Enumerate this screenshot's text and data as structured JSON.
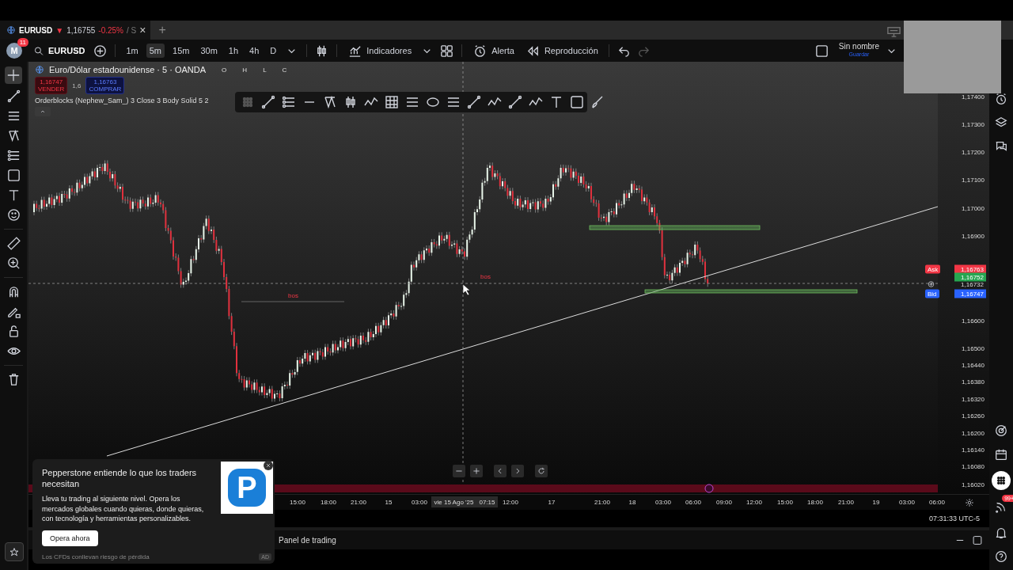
{
  "tab": {
    "symbol": "EURUSD",
    "arrow": "▼",
    "price": "1,16755",
    "change": "-0.25%",
    "extra": "/ S",
    "close": "×",
    "add": "+"
  },
  "toolbar": {
    "avatar": "M",
    "notifications": "11",
    "symbol": "EURUSD",
    "intervals": [
      {
        "label": "1m",
        "selected": false
      },
      {
        "label": "5m",
        "selected": true
      },
      {
        "label": "15m",
        "selected": false
      },
      {
        "label": "30m",
        "selected": false
      },
      {
        "label": "1h",
        "selected": false
      },
      {
        "label": "4h",
        "selected": false
      },
      {
        "label": "D",
        "selected": false
      }
    ],
    "indicators": "Indicadores",
    "alert": "Alerta",
    "replay": "Reproducción",
    "layout_name": "Sin nombre",
    "save": "Guardar"
  },
  "legend": {
    "title": "Euro/Dólar estadounidense · 5 · OANDA",
    "ohlc": [
      "O",
      "H",
      "L",
      "C"
    ],
    "sell": {
      "price": "1,16747",
      "label": "VENDER"
    },
    "spread": "1,6",
    "buy": {
      "price": "1,16763",
      "label": "COMPRAR"
    },
    "indicator": "Orderblocks (Nephew_Sam_) 3 Close 3 Body Solid 5 2"
  },
  "chart_labels": [
    "bos",
    "bos"
  ],
  "price_axis": {
    "labels": [
      "1,17400",
      "1,17300",
      "1,17200",
      "1,17100",
      "1,17000",
      "1,16900",
      "1,16600",
      "1,16500",
      "1,16440",
      "1,16380",
      "1,16320",
      "1,16260",
      "1,16200",
      "1,16140",
      "1,16080",
      "1,16020"
    ],
    "tags": [
      {
        "kind": "ask",
        "label": "Ask",
        "price": "1,16763"
      },
      {
        "kind": "last",
        "price": "1,16752"
      },
      {
        "kind": "crosshair",
        "price": "1,16732"
      },
      {
        "kind": "bid",
        "label": "Bid",
        "price": "1,16747"
      }
    ]
  },
  "time_axis": {
    "labels": [
      "15:00",
      "18:00",
      "21:00",
      "15",
      "03:00",
      "12:00",
      "17",
      "21:00",
      "18",
      "03:00",
      "06:00",
      "09:00",
      "12:00",
      "15:00",
      "18:00",
      "21:00",
      "19",
      "03:00",
      "06:00"
    ],
    "crosshair": {
      "date": "vie 15 Ago '25",
      "time": "07:15"
    }
  },
  "clock": "07:31:33 UTC-5",
  "bottom_panel": {
    "title": "Panel de trading"
  },
  "ad": {
    "title": "Pepperstone entiende lo que los traders necesitan",
    "body": "Lleva tu trading al siguiente nivel. Opera los mercados globales cuando quieras, donde quieras, con tecnología y herramientas personalizables.",
    "button": "Opera ahora",
    "disclaimer": "Los CFDs conllevan riesgo de pérdida",
    "tag": "AD",
    "logo": "P"
  },
  "sidebar": {
    "badge": "99+"
  }
}
